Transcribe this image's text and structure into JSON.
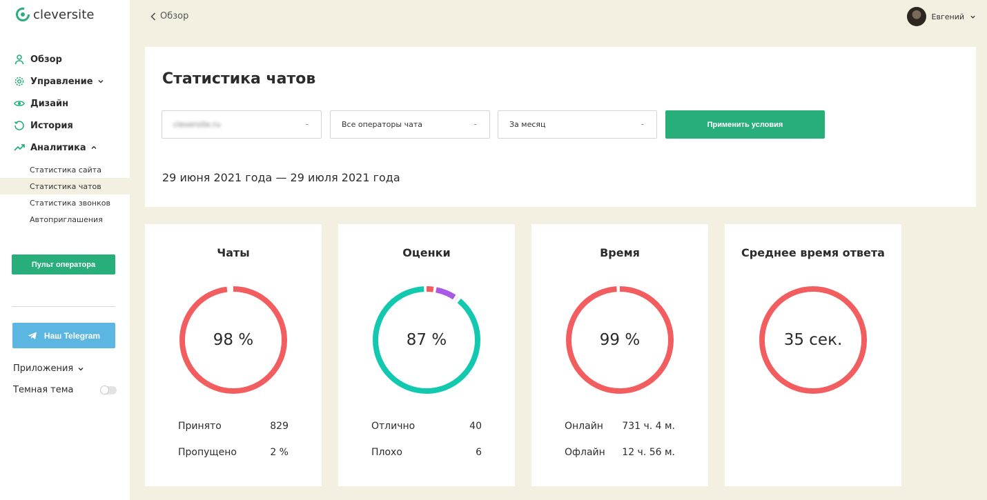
{
  "brand": {
    "name": "cleversite",
    "accent": "#27ae7a"
  },
  "sidebar": {
    "items": [
      {
        "label": "Обзор",
        "icon": "user-icon"
      },
      {
        "label": "Управление",
        "icon": "gear-icon"
      },
      {
        "label": "Дизайн",
        "icon": "eye-icon"
      },
      {
        "label": "История",
        "icon": "history-icon"
      },
      {
        "label": "Аналитика",
        "icon": "trend-icon"
      }
    ],
    "analytics_sub": [
      {
        "label": "Статистика сайта"
      },
      {
        "label": "Статистика чатов",
        "active": true
      },
      {
        "label": "Статистика звонков"
      },
      {
        "label": "Автоприглашения"
      }
    ],
    "operator_button": "Пульт оператора",
    "telegram_button": "Наш Telegram",
    "apps_label": "Приложения",
    "dark_theme_label": "Темная тема",
    "dark_theme_on": false
  },
  "header": {
    "back_label": "Обзор",
    "user_name": "Евгений"
  },
  "main": {
    "title": "Статистика чатов",
    "filters": {
      "site": "cleversite.ru",
      "operators": "Все операторы чата",
      "period": "За месяц",
      "dash": "-"
    },
    "apply_label": "Применить условия",
    "date_range": "29 июня 2021 года — 29 июля 2021 года"
  },
  "stats": [
    {
      "title": "Чаты",
      "value": "98 %",
      "rows": [
        {
          "label": "Принято",
          "value": "829"
        },
        {
          "label": "Пропущено",
          "value": "2 %"
        }
      ],
      "segments": [
        {
          "fraction": 0.98,
          "color": "#f25e60"
        }
      ]
    },
    {
      "title": "Оценки",
      "value": "87 %",
      "rows": [
        {
          "label": "Отлично",
          "value": "40"
        },
        {
          "label": "Плохо",
          "value": "6"
        }
      ],
      "segments": [
        {
          "fraction": 0.03,
          "color": "#f25e60"
        },
        {
          "fraction": 0.07,
          "color": "#a95ae5"
        },
        {
          "fraction": 0.01,
          "color": "#c9c9e6"
        },
        {
          "fraction": 0.89,
          "color": "#12c9b0"
        }
      ]
    },
    {
      "title": "Время",
      "value": "99 %",
      "rows": [
        {
          "label": "Онлайн",
          "value": "731 ч. 4 м."
        },
        {
          "label": "Офлайн",
          "value": "12 ч. 56 м."
        }
      ],
      "segments": [
        {
          "fraction": 0.99,
          "color": "#f25e60"
        }
      ]
    },
    {
      "title": "Среднее время ответа",
      "value": "35 сек.",
      "rows": [],
      "segments": [
        {
          "fraction": 1.0,
          "color": "#f25e60"
        }
      ]
    }
  ]
}
